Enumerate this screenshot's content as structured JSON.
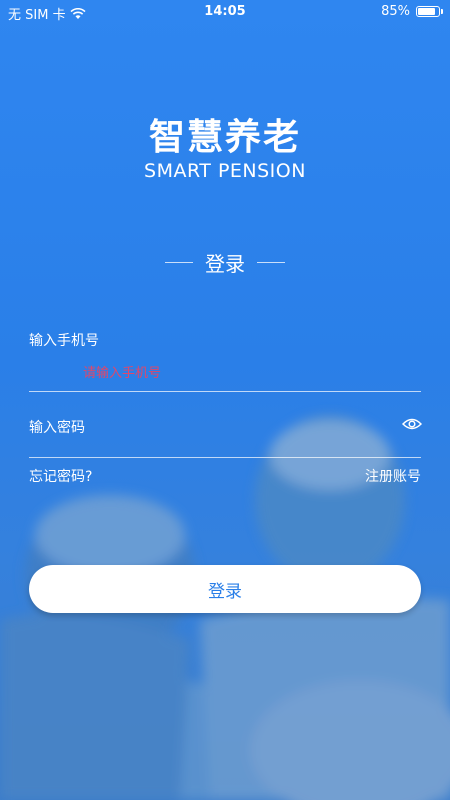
{
  "status_bar": {
    "carrier": "无 SIM 卡",
    "time": "14:05",
    "battery_percent": "85%",
    "battery_level": 0.85
  },
  "header": {
    "title": "智慧养老",
    "subtitle": "SMART PENSION"
  },
  "login_section": {
    "title": "登录"
  },
  "phone_field": {
    "label": "输入手机号",
    "placeholder": "请输入手机号",
    "value": ""
  },
  "password_field": {
    "label": "输入密码",
    "placeholder": "",
    "value": "",
    "toggle_icon": "eye-icon"
  },
  "links": {
    "forgot_password": "忘记密码?",
    "register": "注册账号"
  },
  "login_button": {
    "label": "登录"
  },
  "colors": {
    "background": "#2f86f0",
    "button_text": "#2a7fe8",
    "placeholder_accent": "#e0476a"
  }
}
